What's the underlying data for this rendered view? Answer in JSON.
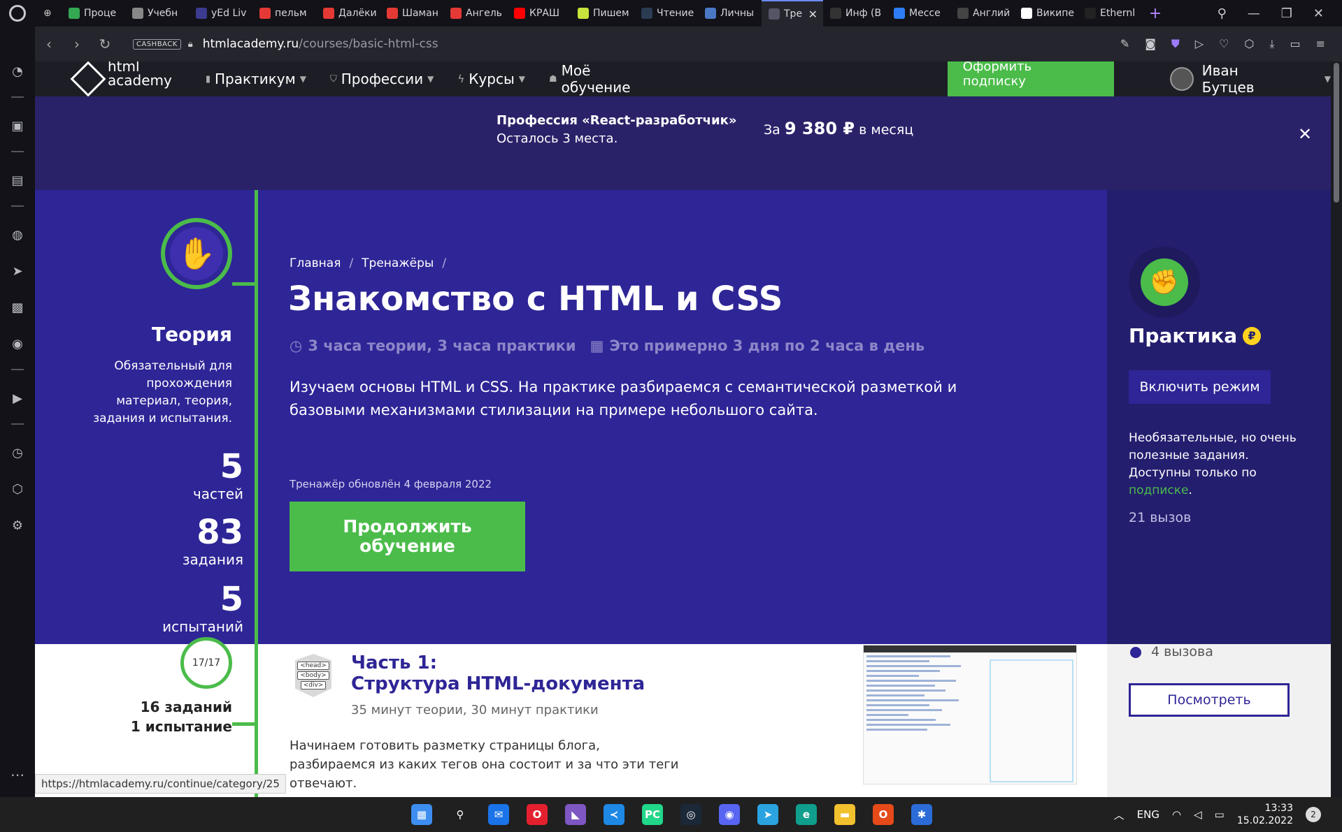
{
  "browser": {
    "tabs": [
      {
        "label": "Проце",
        "color": "#34a853"
      },
      {
        "label": "Учебн",
        "color": "#888888"
      },
      {
        "label": "yEd Liv",
        "color": "#3b3b8f"
      },
      {
        "label": "пельм",
        "color": "#e53935"
      },
      {
        "label": "Далёки",
        "color": "#e53935"
      },
      {
        "label": "Шаман",
        "color": "#e53935"
      },
      {
        "label": "Ангель",
        "color": "#e53935"
      },
      {
        "label": "КРАШ",
        "color": "#ff0000"
      },
      {
        "label": "Пишем",
        "color": "#c6e43b"
      },
      {
        "label": "Чтение",
        "color": "#2a3b52"
      },
      {
        "label": "Личны",
        "color": "#4a78c5"
      },
      {
        "label": "Тре",
        "color": "#555566",
        "active": true
      },
      {
        "label": "Инф (В",
        "color": "#333333"
      },
      {
        "label": "Мессе",
        "color": "#2e7df7"
      },
      {
        "label": "Англий",
        "color": "#444444"
      },
      {
        "label": "Википе",
        "color": "#ffffff"
      },
      {
        "label": "Ethernl",
        "color": "#222222"
      }
    ],
    "cashback_label": "CASHBACK",
    "url_domain": "htmlacademy.ru",
    "url_path": "/courses/basic-html-css",
    "status_url": "https://htmlacademy.ru/continue/category/25"
  },
  "site": {
    "logo_line1": "html",
    "logo_line2": "academy",
    "menu": [
      {
        "label": "Практикум",
        "icon": "bar-chart-icon",
        "has_dropdown": true
      },
      {
        "label": "Профессии",
        "icon": "badge-icon",
        "has_dropdown": true
      },
      {
        "label": "Курсы",
        "icon": "lightning-icon",
        "has_dropdown": true
      },
      {
        "label": "Моё обучение",
        "icon": "user-group-icon",
        "has_dropdown": false
      }
    ],
    "subscribe_label": "Оформить подписку",
    "user_name": "Иван Бутцев"
  },
  "promo": {
    "title": "Профессия «React-разработчик»",
    "subtitle": "Осталось 3 места.",
    "price_prefix": "За",
    "price": "9 380 ₽",
    "price_suffix": "в месяц"
  },
  "theory": {
    "title": "Теория",
    "description": "Обязательный для прохождения материал, теория, задания и испытания.",
    "stats": [
      {
        "value": "5",
        "label": "частей"
      },
      {
        "value": "83",
        "label": "задания"
      },
      {
        "value": "5",
        "label": "испытаний"
      }
    ]
  },
  "course": {
    "breadcrumb": [
      "Главная",
      "Тренажёры"
    ],
    "title": "Знакомство с HTML и CSS",
    "duration": "3 часа теории, 3 часа практики",
    "schedule": "Это примерно 3 дня по 2 часа в день",
    "description": "Изучаем основы HTML и CSS. На практике разбираемся с семантической разметкой и базовыми механизмами стилизации на примере небольшого сайта.",
    "updated": "Тренажёр обновлён 4 февраля 2022",
    "continue_label": "Продолжить обучение"
  },
  "practice": {
    "title": "Практика",
    "coin": "₽",
    "enable_label": "Включить режим",
    "description_prefix": "Необязательные, но очень полезные задания. Доступны только по",
    "link_label": "подписке",
    "description_suffix": ".",
    "count": "21 вызов"
  },
  "part1": {
    "progress": "17/17",
    "tasks": "16 заданий",
    "tests": "1 испытание",
    "icon_tags": [
      "<head>",
      "<body>",
      "<div>"
    ],
    "title_line1": "Часть 1:",
    "title_line2": "Структура HTML-документа",
    "meta": "35 минут теории, 30 минут практики",
    "description": "Начинаем готовить разметку страницы блога, разбираемся из каких тегов она состоит и за что эти теги отвечают.",
    "practice_count": "4 вызова",
    "view_label": "Посмотреть"
  },
  "taskbar": {
    "apps": [
      {
        "name": "start-icon",
        "color": "#3d8ef0",
        "glyph": "▦"
      },
      {
        "name": "search-icon",
        "color": "#202020",
        "glyph": "⚲"
      },
      {
        "name": "mail-icon",
        "color": "#1a73e8",
        "glyph": "✉"
      },
      {
        "name": "opera-icon",
        "color": "#e5202e",
        "glyph": "O"
      },
      {
        "name": "visual-studio-icon",
        "color": "#7e57c2",
        "glyph": "◣"
      },
      {
        "name": "vscode-icon",
        "color": "#1e88e5",
        "glyph": "≺"
      },
      {
        "name": "pycharm-icon",
        "color": "#21d789",
        "glyph": "PC"
      },
      {
        "name": "steam-icon",
        "color": "#1b2838",
        "glyph": "◎"
      },
      {
        "name": "discord-icon",
        "color": "#5865f2",
        "glyph": "◉"
      },
      {
        "name": "telegram-icon",
        "color": "#2aa3e0",
        "glyph": "➤"
      },
      {
        "name": "edge-icon",
        "color": "#0f9f8c",
        "glyph": "e"
      },
      {
        "name": "folder-icon",
        "color": "#f2c12e",
        "glyph": "▬"
      },
      {
        "name": "office-icon",
        "color": "#e64a19",
        "glyph": "O"
      },
      {
        "name": "app-icon",
        "color": "#2b6cd8",
        "glyph": "✱"
      }
    ],
    "lang": "ENG",
    "time": "13:33",
    "date": "15.02.2022",
    "notifications": "2"
  }
}
